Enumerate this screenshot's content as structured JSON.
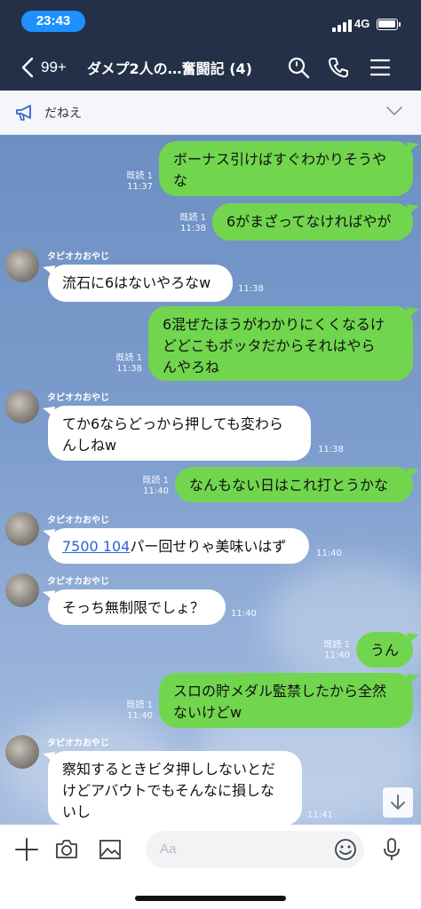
{
  "status": {
    "time": "23:43",
    "network": "4G"
  },
  "header": {
    "back_count": "99+",
    "title": "ダメプ2人の…奮闘記 (4)"
  },
  "announcement": {
    "text": "だねえ"
  },
  "messages": [
    {
      "from": "me",
      "lines": [
        "ボーナス引けばすぐわかりそうや",
        "な"
      ],
      "read": "既読 1",
      "time": "11:37"
    },
    {
      "from": "me",
      "lines": [
        "6がまざってなければやが"
      ],
      "read": "既読 1",
      "time": "11:38"
    },
    {
      "from": "them",
      "sender": "タピオカおやじ",
      "lines": [
        "流石に6はないやろなw"
      ],
      "time": "11:38"
    },
    {
      "from": "me",
      "lines": [
        "6混ぜたほうがわかりにくくなるけ",
        "どどこもボッタだからそれはやら",
        "んやろね"
      ],
      "read": "既読 1",
      "time": "11:38"
    },
    {
      "from": "them",
      "sender": "タピオカおやじ",
      "lines": [
        "てか6ならどっから押しても変わら",
        "んしねw"
      ],
      "time": "11:38"
    },
    {
      "from": "me",
      "lines": [
        "なんもない日はこれ打とうかな"
      ],
      "read": "既読 1",
      "time": "11:40"
    },
    {
      "from": "them",
      "sender": "タピオカおやじ",
      "link": "7500 104",
      "after_link": "パー回せりゃ美味いはず",
      "time": "11:40"
    },
    {
      "from": "them",
      "sender": "タピオカおやじ",
      "lines": [
        "そっち無制限でしょ？"
      ],
      "time": "11:40"
    },
    {
      "from": "me",
      "lines": [
        "うん"
      ],
      "read": "既読 1",
      "time": "11:40"
    },
    {
      "from": "me",
      "lines": [
        "スロの貯メダル監禁したから全然",
        "ないけどw"
      ],
      "read": "既読 1",
      "time": "11:40"
    },
    {
      "from": "them",
      "sender": "タピオカおやじ",
      "lines": [
        "察知するときビタ押ししないとだ",
        "けどアバウトでもそんなに損しな",
        "いし"
      ],
      "time": "11:41"
    }
  ],
  "input": {
    "placeholder": "Aa"
  },
  "colors": {
    "header": "#243048",
    "my_bubble": "#71d64e",
    "their_bubble": "#ffffff",
    "time_pill": "#1e90ff"
  },
  "icons": [
    "search-icon",
    "phone-icon",
    "menu-icon",
    "megaphone-icon",
    "chevron-down-icon",
    "plus-icon",
    "camera-icon",
    "image-icon",
    "emoji-icon",
    "mic-icon",
    "arrow-down-icon"
  ]
}
